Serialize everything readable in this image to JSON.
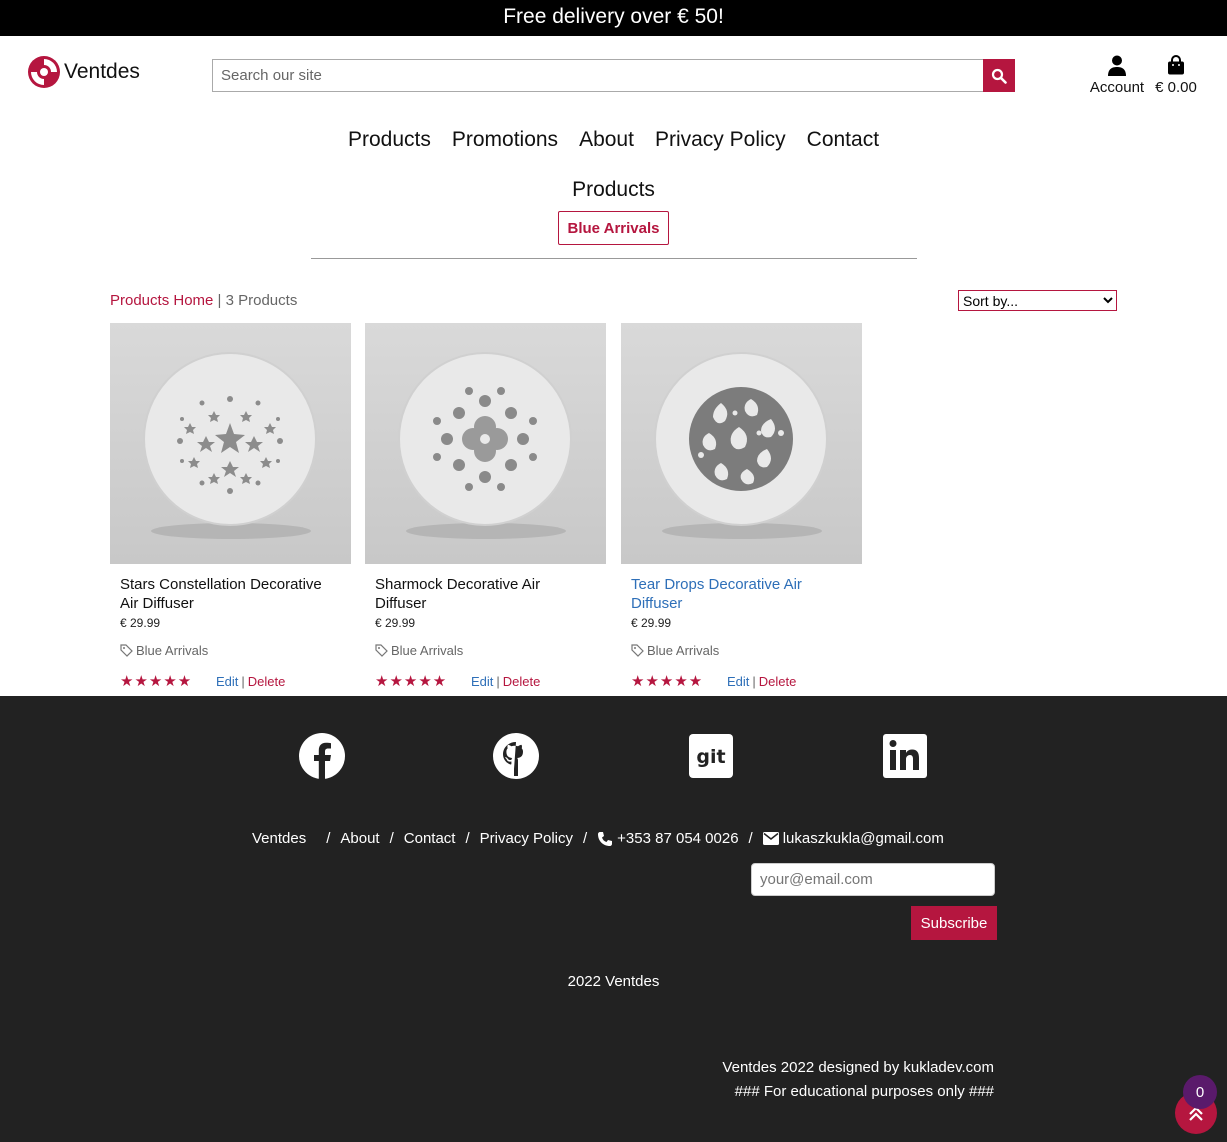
{
  "banner": {
    "text": "Free delivery over € 50!"
  },
  "header": {
    "logo_text": "Ventdes",
    "search_placeholder": "Search our site",
    "account_label": "Account",
    "bag_total": "€ 0.00"
  },
  "nav": {
    "items": [
      "Products",
      "Promotions",
      "About",
      "Privacy Policy",
      "Contact"
    ]
  },
  "page": {
    "heading": "Products",
    "category_badge": "Blue Arrivals",
    "breadcrumb_home": "Products Home",
    "breadcrumb_sep": " | ",
    "product_count": "3 Products",
    "sort_label": "Sort by..."
  },
  "products": [
    {
      "title": "Stars Constellation Decorative Air Diffuser",
      "price": "€ 29.99",
      "category": "Blue Arrivals",
      "rating_stars": 5,
      "edit": "Edit",
      "delete": "Delete",
      "pattern": "stars"
    },
    {
      "title": "Sharmock Decorative Air Diffuser",
      "price": "€ 29.99",
      "category": "Blue Arrivals",
      "rating_stars": 5,
      "edit": "Edit",
      "delete": "Delete",
      "pattern": "shamrock"
    },
    {
      "title": "Tear Drops Decorative Air Diffuser",
      "price": "€ 29.99",
      "category": "Blue Arrivals",
      "rating_stars": 5,
      "edit": "Edit",
      "delete": "Delete",
      "pattern": "teardrops"
    }
  ],
  "footer": {
    "social_icons": [
      "facebook-icon",
      "github-icon",
      "git-icon",
      "linkedin-icon"
    ],
    "nav": {
      "brand": "Ventdes",
      "about": "About",
      "contact": "Contact",
      "privacy": "Privacy Policy",
      "phone": "+353 87 054 0026",
      "email": "lukaszkukla@gmail.com"
    },
    "email_placeholder": "your@email.com",
    "subscribe_label": "Subscribe",
    "copyright": "2022 Ventdes",
    "credit_line1": "Ventdes 2022 designed by kukladev.com",
    "credit_line2": "### For educational purposes only ###"
  },
  "widgets": {
    "badge_count": "0"
  },
  "colors": {
    "accent": "#b5163f",
    "link": "#2e6fb8",
    "footer_bg": "#222222",
    "badge": "#5a1a6b"
  }
}
